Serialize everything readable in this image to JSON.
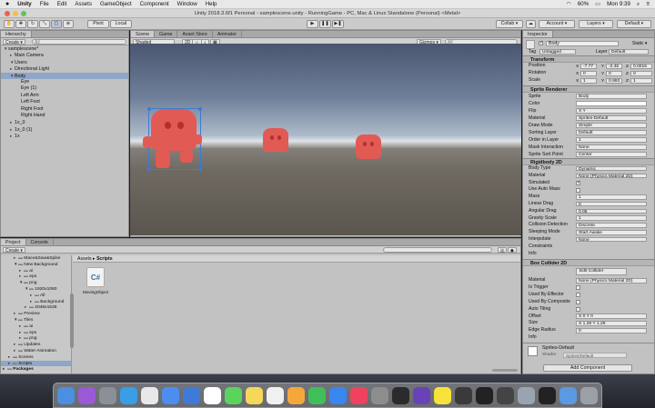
{
  "menubar": {
    "apple": "",
    "app": "Unity",
    "items": [
      "File",
      "Edit",
      "Assets",
      "GameObject",
      "Component",
      "Window",
      "Help"
    ],
    "battery": "60%",
    "clock": "Mon 9:39"
  },
  "window": {
    "title": "Unity 2018.3.6f1 Personal - samplescene.unity - RunningGame - PC, Mac & Linux Standalone (Personal) <Metal>"
  },
  "toolbar": {
    "pivot": "Pivot",
    "local": "Local",
    "collab": "Collab ▾",
    "account": "Account ▾",
    "layers": "Layers ▾",
    "layout": "Default ▾"
  },
  "hierarchy": {
    "tab": "Hierarchy",
    "create": "Create ▾",
    "search_placeholder": "All",
    "items": [
      {
        "label": "samplescene*",
        "depth": 0,
        "open": true
      },
      {
        "label": "Main Camera",
        "depth": 1
      },
      {
        "label": "Users",
        "depth": 1,
        "open": true
      },
      {
        "label": "Directional Light",
        "depth": 1
      },
      {
        "label": "Body",
        "depth": 1,
        "open": true,
        "selected": true
      },
      {
        "label": "Eye",
        "depth": 2
      },
      {
        "label": "Eye (1)",
        "depth": 2
      },
      {
        "label": "Left Arm",
        "depth": 2
      },
      {
        "label": "Left Foot",
        "depth": 2
      },
      {
        "label": "Right Foot",
        "depth": 2
      },
      {
        "label": "Right Hand",
        "depth": 2
      },
      {
        "label": "1x_0",
        "depth": 1
      },
      {
        "label": "1x_0 (1)",
        "depth": 1
      },
      {
        "label": "1x",
        "depth": 1
      }
    ]
  },
  "scene": {
    "tabs": [
      "Scene",
      "Game",
      "Asset Store",
      "Animator"
    ],
    "shading": "Shaded",
    "mode2d": "2D",
    "gizmos": "Gizmos ▾",
    "search_placeholder": "All"
  },
  "project": {
    "tabs": [
      "Project",
      "Console"
    ],
    "create": "Create ▾",
    "breadcrumb": [
      "Assets",
      "Scripts"
    ],
    "tree": [
      {
        "label": "Mace&Saw&Spike",
        "depth": 2
      },
      {
        "label": "New Background",
        "depth": 2,
        "open": true
      },
      {
        "label": "ai",
        "depth": 3
      },
      {
        "label": "eps",
        "depth": 3
      },
      {
        "label": "png",
        "depth": 3,
        "open": true
      },
      {
        "label": "1920x1080",
        "depth": 4,
        "open": true
      },
      {
        "label": "All",
        "depth": 5
      },
      {
        "label": "Background",
        "depth": 5
      },
      {
        "label": "2048x1536",
        "depth": 4
      },
      {
        "label": "Preview",
        "depth": 2
      },
      {
        "label": "Tiles",
        "depth": 2,
        "open": true
      },
      {
        "label": "ai",
        "depth": 3
      },
      {
        "label": "eps",
        "depth": 3
      },
      {
        "label": "png",
        "depth": 3
      },
      {
        "label": "Updates",
        "depth": 2
      },
      {
        "label": "Water Animation",
        "depth": 2
      },
      {
        "label": "Scenes",
        "depth": 1
      },
      {
        "label": "Scripts",
        "depth": 1,
        "selected": true
      },
      {
        "label": "Packages",
        "depth": 0,
        "bold": true
      }
    ],
    "asset": {
      "icon_text": "C#",
      "name": "MovingObject"
    }
  },
  "inspector": {
    "tab": "Inspector",
    "object_name": "Body",
    "static": "Static ▾",
    "tag_label": "Tag",
    "tag": "Untagged",
    "layer_label": "Layer",
    "layer": "Default",
    "transform": {
      "title": "Transform",
      "position": {
        "label": "Position",
        "x": "-7.77",
        "y": "-2.45",
        "z": "0.0015"
      },
      "rotation": {
        "label": "Rotation",
        "x": "0",
        "y": "0",
        "z": "0"
      },
      "scale": {
        "label": "Scale",
        "x": "1",
        "y": "0.993",
        "z": "1"
      }
    },
    "sprite_renderer": {
      "title": "Sprite Renderer",
      "rows": [
        {
          "label": "Sprite",
          "value": "Body"
        },
        {
          "label": "Color",
          "value": ""
        },
        {
          "label": "Flip",
          "value": "X  Y"
        },
        {
          "label": "Material",
          "value": "Sprites-Default"
        },
        {
          "label": "Draw Mode",
          "value": "Simple"
        },
        {
          "label": "Sorting Layer",
          "value": "Default"
        },
        {
          "label": "Order in Layer",
          "value": "1"
        },
        {
          "label": "Mask Interaction",
          "value": "None"
        },
        {
          "label": "Sprite Sort Point",
          "value": "Center"
        }
      ]
    },
    "rigidbody": {
      "title": "Rigidbody 2D",
      "rows": [
        {
          "label": "Body Type",
          "value": "Dynamic"
        },
        {
          "label": "Material",
          "value": "None (Physics Material 2D)"
        },
        {
          "label": "Simulated",
          "value": "✓"
        },
        {
          "label": "Use Auto Mass",
          "value": ""
        },
        {
          "label": "Mass",
          "value": "1"
        },
        {
          "label": "Linear Drag",
          "value": "0"
        },
        {
          "label": "Angular Drag",
          "value": "0.05"
        },
        {
          "label": "Gravity Scale",
          "value": "1"
        },
        {
          "label": "Collision Detection",
          "value": "Discrete"
        },
        {
          "label": "Sleeping Mode",
          "value": "Start Awake"
        },
        {
          "label": "Interpolate",
          "value": "None"
        },
        {
          "label": "Constraints",
          "value": ""
        },
        {
          "label": "Info",
          "value": ""
        }
      ]
    },
    "box_collider": {
      "title": "Box Collider 2D",
      "edit_button": "Edit Collider",
      "rows": [
        {
          "label": "Material",
          "value": "None (Physics Material 2D)"
        },
        {
          "label": "Is Trigger",
          "value": ""
        },
        {
          "label": "Used By Effector",
          "value": ""
        },
        {
          "label": "Used By Composite",
          "value": ""
        },
        {
          "label": "Auto Tiling",
          "value": ""
        },
        {
          "label": "Offset",
          "value": "X 0   Y 0"
        },
        {
          "label": "Size",
          "value": "X 1.29  Y 1.29"
        },
        {
          "label": "Edge Radius",
          "value": "0"
        },
        {
          "label": "Info",
          "value": ""
        }
      ]
    },
    "material": {
      "name": "Sprites-Default",
      "shader_label": "Shader",
      "shader": "Sprites/Default"
    },
    "add_component": "Add Component"
  },
  "colors": {
    "selection": "#8ea6c8",
    "ghost": "#e25a54",
    "panel": "#c2c2c2"
  },
  "dock": {
    "icons": [
      "finder-icon",
      "siri-icon",
      "launchpad-icon",
      "safari-icon",
      "chrome-icon",
      "mail-icon",
      "xcode-icon",
      "calendar-icon",
      "messages-icon",
      "notes-icon",
      "reminders-icon",
      "photos-icon",
      "facetime-icon",
      "appstore-icon",
      "music-icon",
      "preferences-icon",
      "terminal-icon",
      "visualstudio-icon",
      "kakaotalk-icon",
      "talk-icon",
      "unity-icon",
      "unityhub-icon",
      "preview-icon",
      "github-icon",
      "finder2-icon",
      "trash-icon"
    ]
  }
}
